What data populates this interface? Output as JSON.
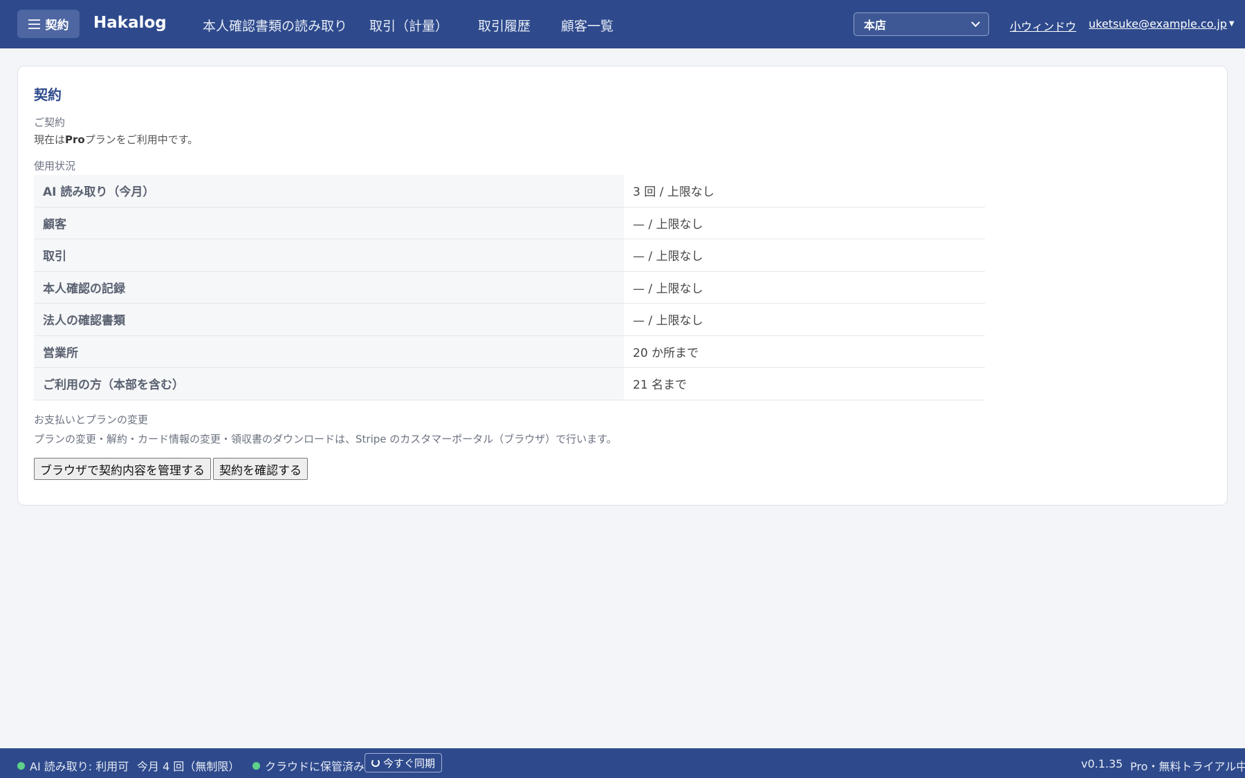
{
  "header": {
    "menu_label": "契約",
    "brand": "Hakalog",
    "nav": [
      {
        "label": "本人確認書類の読み取り"
      },
      {
        "label": "取引（計量）"
      },
      {
        "label": "取引履歴"
      },
      {
        "label": "顧客一覧"
      }
    ],
    "store_select": {
      "value": "本店"
    },
    "small_window_label": "小ウィンドウ",
    "user_email": "uketsuke@example.co.jp"
  },
  "main": {
    "title": "契約",
    "contract_label": "ご契約",
    "plan_prefix": "現在は",
    "plan_name": "Pro",
    "plan_suffix": "プランをご利用中です。",
    "usage_label": "使用状況",
    "usage_rows": [
      {
        "key": "AI 読み取り（今月）",
        "value": "3 回 / 上限なし"
      },
      {
        "key": "顧客",
        "value": "— / 上限なし"
      },
      {
        "key": "取引",
        "value": "— / 上限なし"
      },
      {
        "key": "本人確認の記録",
        "value": "— / 上限なし"
      },
      {
        "key": "法人の確認書類",
        "value": "— / 上限なし"
      },
      {
        "key": "営業所",
        "value": "20 か所まで"
      },
      {
        "key": "ご利用の方（本部を含む）",
        "value": "21 名まで"
      }
    ],
    "payment_label": "お支払いとプランの変更",
    "payment_desc": "プランの変更・解約・カード情報の変更・領収書のダウンロードは、Stripe のカスタマーポータル（ブラウザ）で行います。",
    "manage_button": "ブラウザで契約内容を管理する",
    "confirm_button": "契約を確認する"
  },
  "status": {
    "ai_status": "AI 読み取り: 利用可",
    "monthly_usage": "今月 4 回（無制限）",
    "cloud_status": "クラウドに保管済み",
    "sync_button": "今すぐ同期",
    "version": "v0.1.35",
    "plan_status": "Pro・無料トライアル中"
  },
  "colors": {
    "header_bg": "#2e4a8c",
    "status_dot": "#5fd18a",
    "page_bg": "#f3f5f8"
  }
}
